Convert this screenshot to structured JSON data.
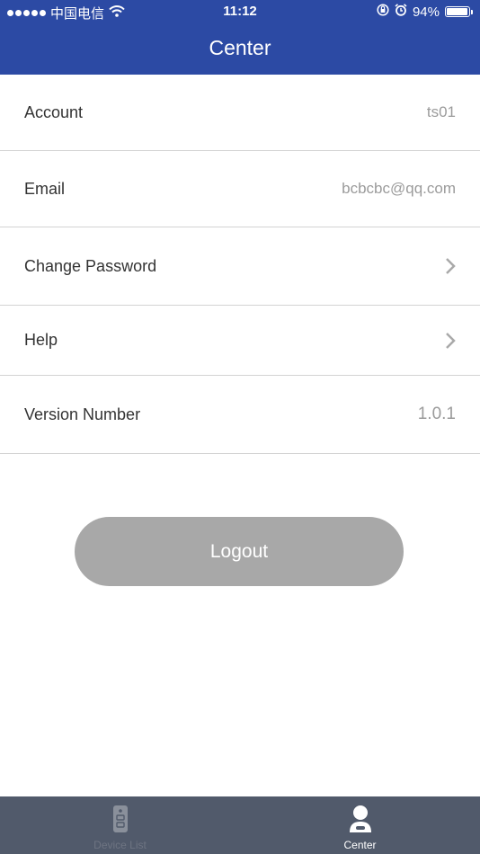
{
  "status_bar": {
    "carrier": "中国电信",
    "time": "11:12",
    "battery": "94%",
    "battery_level": 0.94
  },
  "nav": {
    "title": "Center"
  },
  "rows": [
    {
      "label": "Account",
      "value": "ts01"
    },
    {
      "label": "Email",
      "value": "bcbcbc@qq.com"
    },
    {
      "label": "Change Password",
      "icon": "chevron-right-icon"
    },
    {
      "label": "Help",
      "icon": "chevron-right-icon"
    },
    {
      "label": "Version Number",
      "value": "1.0.1"
    }
  ],
  "logout_label": "Logout",
  "tab_bar": {
    "tabs": [
      {
        "label": "Device List",
        "icon": "device-icon",
        "active": false
      },
      {
        "label": "Center",
        "icon": "user-icon",
        "active": true
      }
    ]
  },
  "colors": {
    "header": "#2c4aa4",
    "tab_bar": "#515a6b",
    "logout_button": "#a8a8a8"
  }
}
